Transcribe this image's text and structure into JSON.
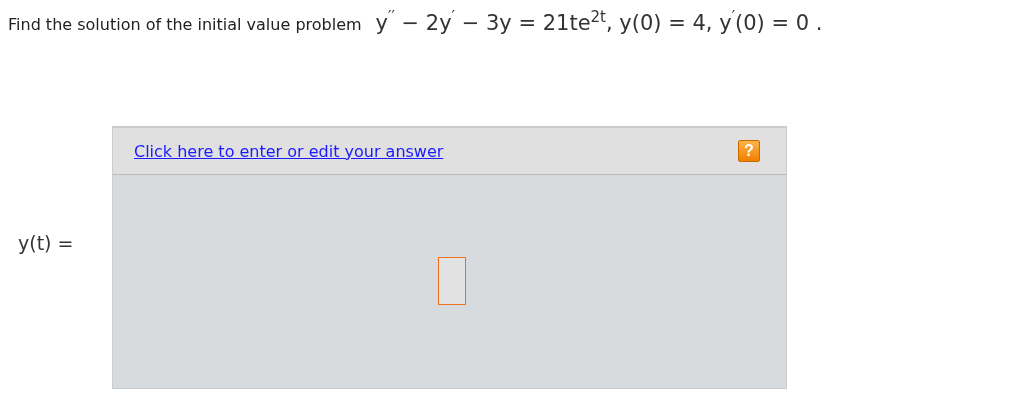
{
  "question": {
    "prompt": "Find the solution of the initial value problem",
    "equation": "y$^{′′}$ − 2y$^{′}$ − 3y = 21te$^{2t}$,  y(0) = 4,  y$^{′}$(0) = 0 ."
  },
  "answer": {
    "label": "y(t) =",
    "edit_link": "Click here to enter or edit your answer",
    "help": "?"
  }
}
